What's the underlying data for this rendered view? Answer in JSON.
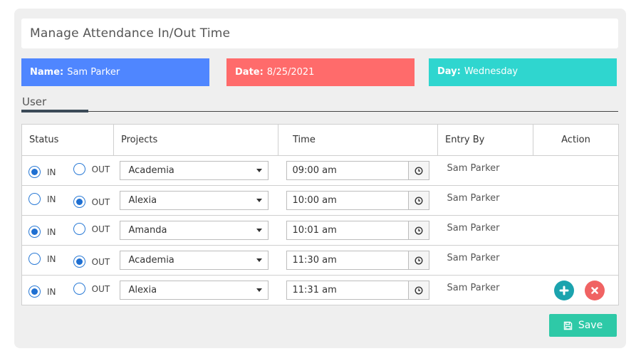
{
  "page": {
    "title": "Manage Attendance In/Out Time"
  },
  "info": {
    "name_label": "Name:",
    "name_value": "Sam Parker",
    "name_color": "#4f86ff",
    "date_label": "Date:",
    "date_value": "8/25/2021",
    "date_color": "#ff6b6b",
    "day_label": "Day:",
    "day_value": "Wednesday",
    "day_color": "#2fd6cf"
  },
  "tabs": {
    "user_label": "User"
  },
  "table": {
    "headers": {
      "status": "Status",
      "projects": "Projects",
      "time": "Time",
      "entry_by": "Entry By",
      "action": "Action"
    },
    "in_label": "IN",
    "out_label": "OUT",
    "rows": [
      {
        "status": "IN",
        "project": "Academia",
        "time": "09:00 am",
        "entry_by": "Sam Parker"
      },
      {
        "status": "OUT",
        "project": "Alexia",
        "time": "10:00 am",
        "entry_by": "Sam Parker"
      },
      {
        "status": "IN",
        "project": "Amanda",
        "time": "10:01 am",
        "entry_by": "Sam Parker"
      },
      {
        "status": "OUT",
        "project": "Academia",
        "time": "11:30 am",
        "entry_by": "Sam Parker"
      },
      {
        "status": "IN",
        "project": "Alexia",
        "time": "11:31 am",
        "entry_by": "Sam Parker"
      }
    ],
    "actions": {
      "add_icon": "plus-icon",
      "remove_icon": "close-icon",
      "add_color": "#1ba3ae",
      "remove_color": "#f06363"
    }
  },
  "footer": {
    "save_label": "Save",
    "save_icon": "floppy-disk-icon",
    "save_color": "#2ec9a7"
  }
}
